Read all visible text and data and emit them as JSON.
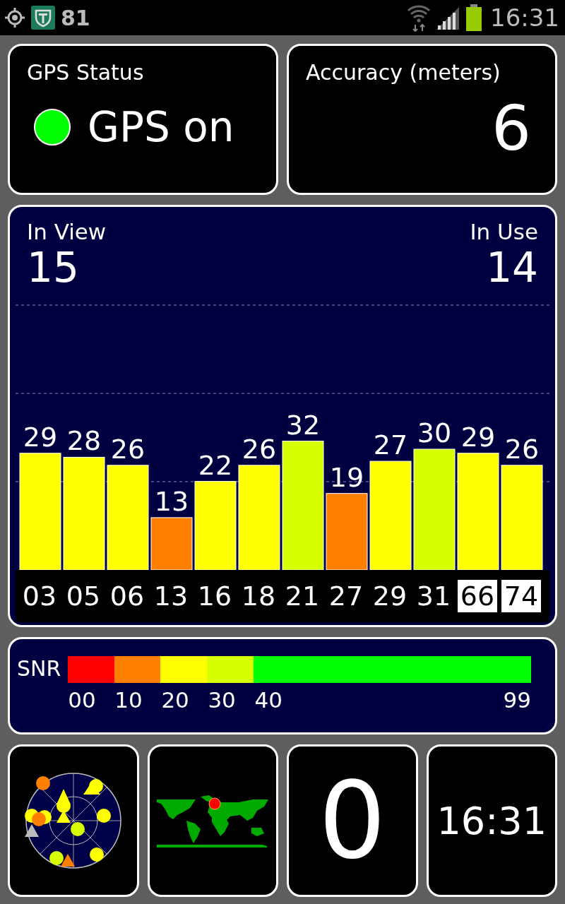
{
  "status_bar": {
    "notification_count": "81",
    "time": "16:31"
  },
  "gps_status": {
    "title": "GPS Status",
    "state": "GPS on",
    "on": true
  },
  "accuracy": {
    "title": "Accuracy (meters)",
    "value": "6"
  },
  "satellites": {
    "in_view_label": "In View",
    "in_view": "15",
    "in_use_label": "In Use",
    "in_use": "14",
    "chart_data": {
      "type": "bar",
      "categories": [
        "03",
        "05",
        "06",
        "13",
        "16",
        "18",
        "21",
        "27",
        "29",
        "31",
        "66",
        "74"
      ],
      "values": [
        29,
        28,
        26,
        13,
        22,
        26,
        32,
        19,
        27,
        30,
        29,
        26
      ],
      "data_labels": true
    },
    "category_styles": [
      {
        "inverted": false
      },
      {
        "inverted": false
      },
      {
        "inverted": false
      },
      {
        "inverted": false
      },
      {
        "inverted": false
      },
      {
        "inverted": false
      },
      {
        "inverted": false
      },
      {
        "inverted": false
      },
      {
        "inverted": false
      },
      {
        "inverted": false
      },
      {
        "inverted": true
      },
      {
        "inverted": true
      }
    ]
  },
  "snr_legend": {
    "label": "SNR",
    "segments": [
      {
        "from": "00",
        "color": "#ff0000"
      },
      {
        "from": "10",
        "color": "#ff8000"
      },
      {
        "from": "20",
        "color": "#ffff00"
      },
      {
        "from": "30",
        "color": "#d8ff00"
      },
      {
        "from": "40",
        "color": "#00ff00"
      }
    ],
    "max": "99"
  },
  "tiles": {
    "count": "0",
    "clock": "16:31"
  }
}
